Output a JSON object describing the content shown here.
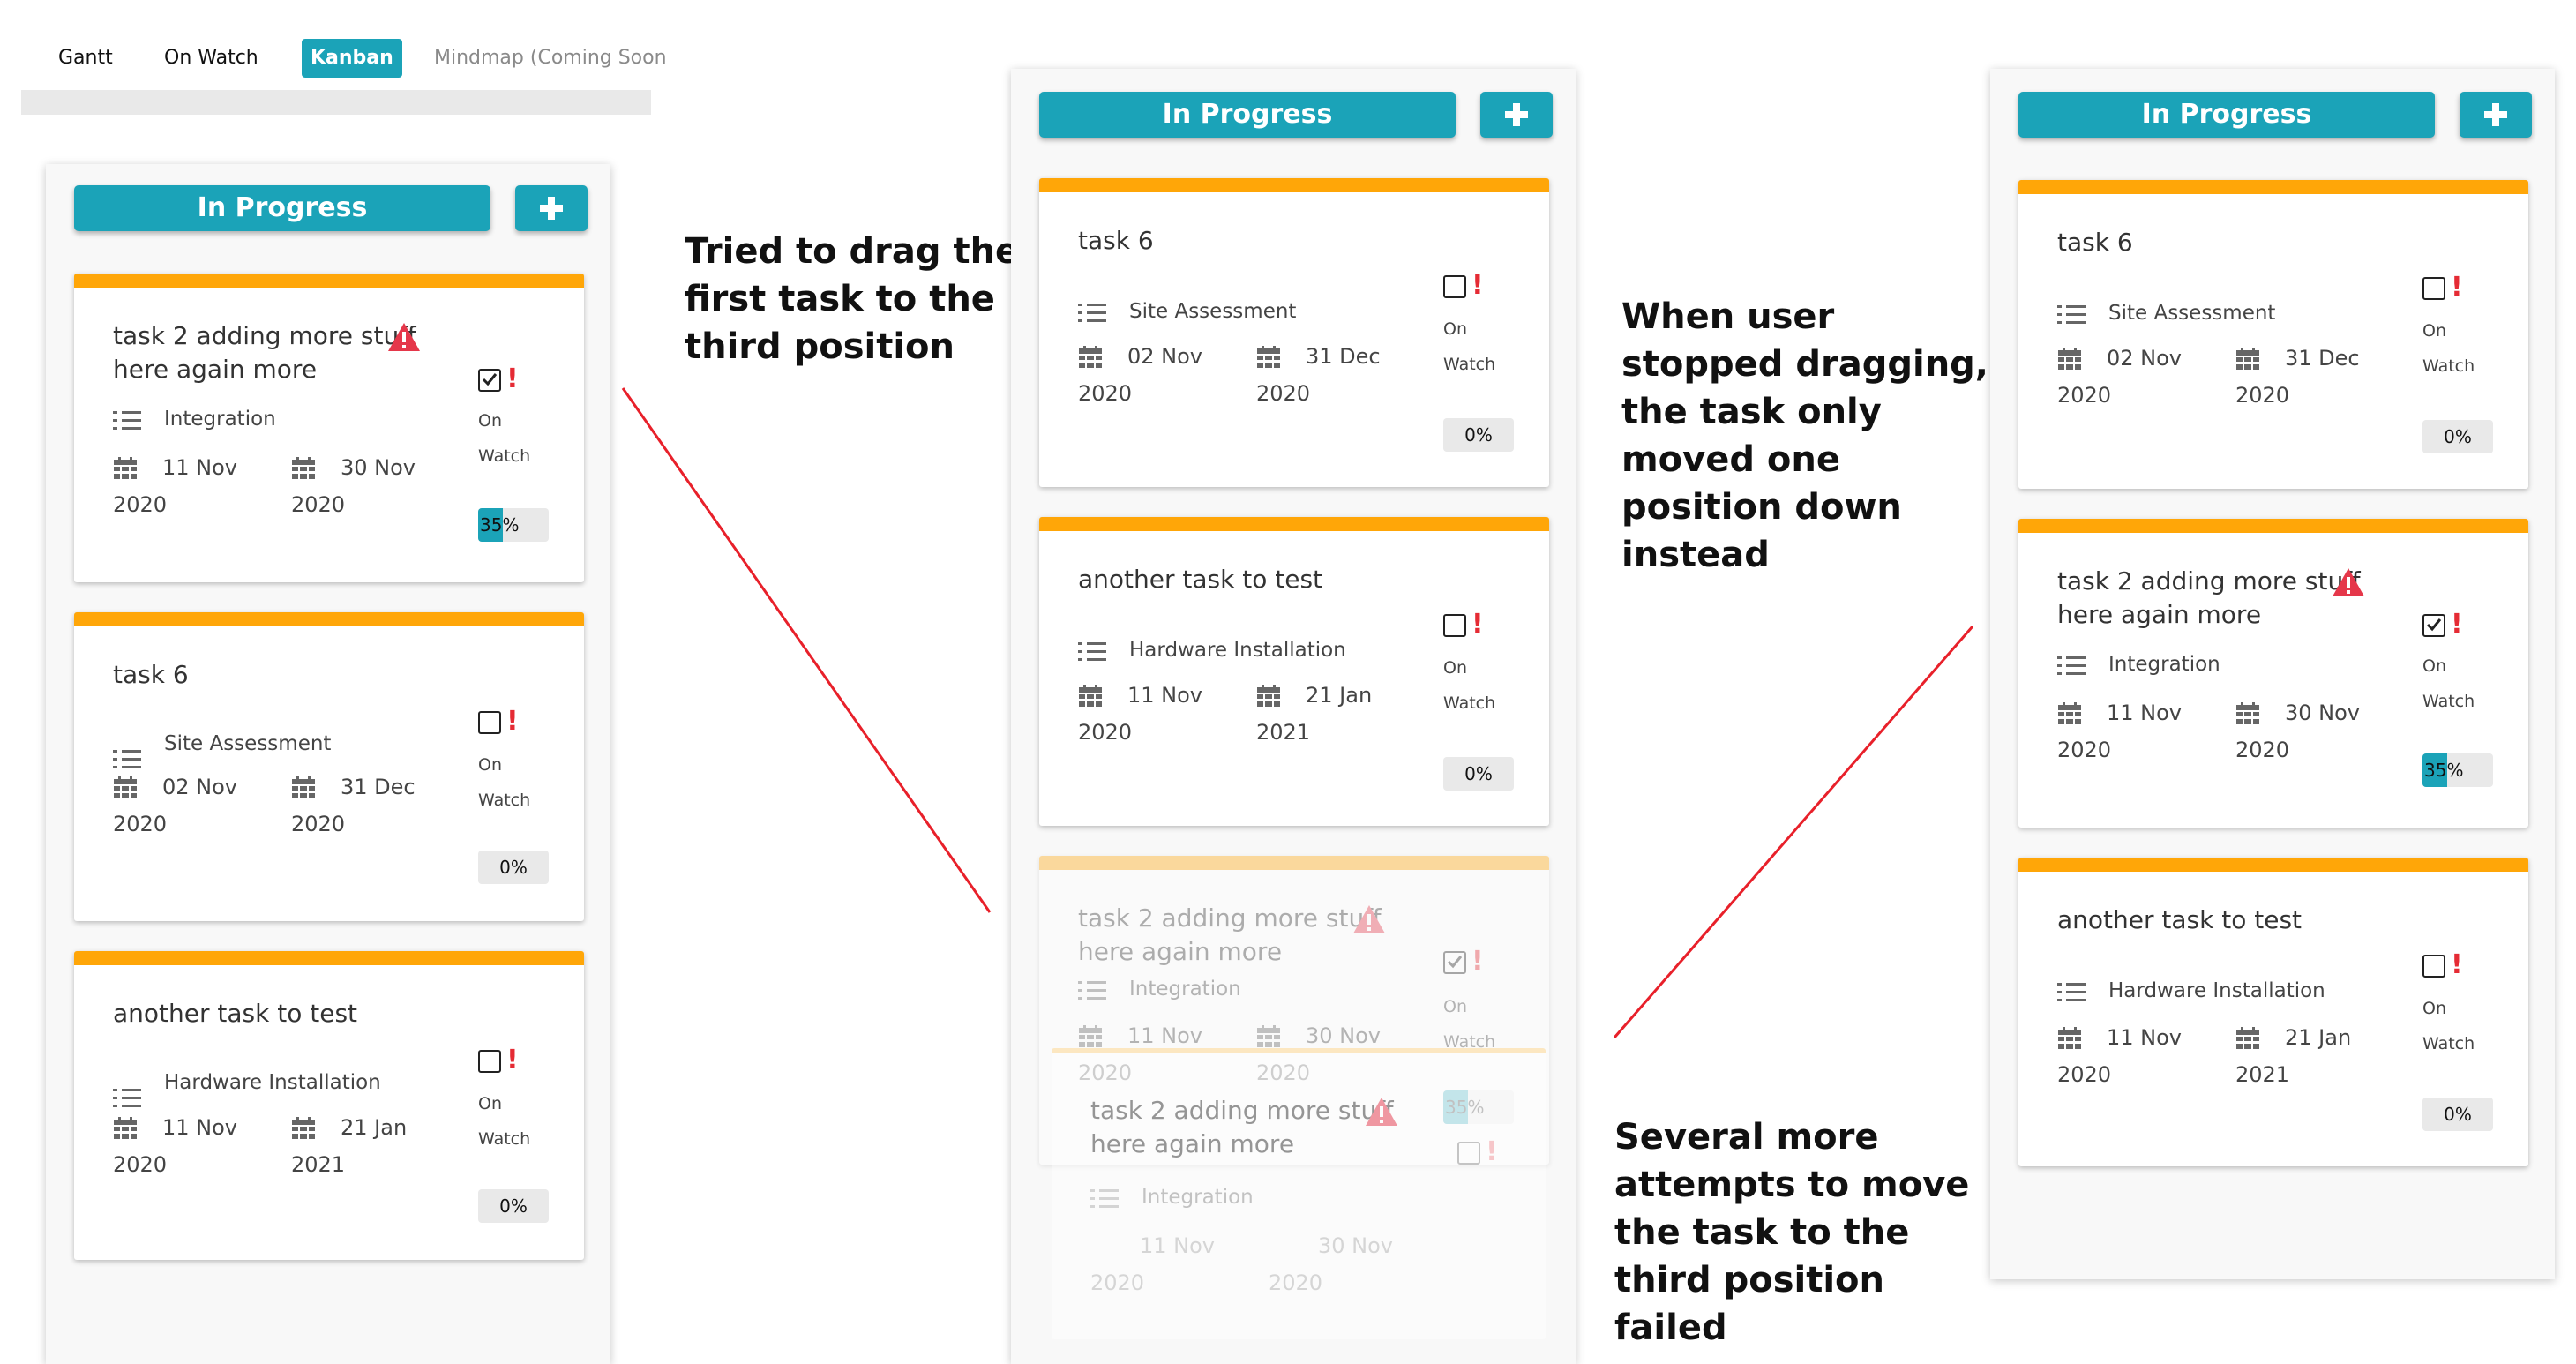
{
  "nav": {
    "tabs": [
      {
        "label": "Gantt",
        "active": false
      },
      {
        "label": "On Watch",
        "active": false
      },
      {
        "label": "Kanban",
        "active": true
      },
      {
        "label": "Mindmap (Coming Soon",
        "active": false
      }
    ]
  },
  "colors": {
    "accent": "#1ba3b8",
    "card_top": "#ffa608",
    "warning": "#e5374a",
    "flag": "#e52b34"
  },
  "icons": {
    "add": "plus-icon",
    "warning": "warning-triangle-icon",
    "category": "checklist-icon",
    "date": "calendar-icon",
    "watch": "checkbox-icon",
    "flag": "exclamation-icon"
  },
  "before": {
    "column_title": "In Progress",
    "cards": [
      {
        "title": "task 2 adding more stuff here again more",
        "warning": true,
        "category": "Integration",
        "start_day": "11 Nov",
        "start_year": "2020",
        "end_day": "30 Nov",
        "end_year": "2020",
        "watched": true,
        "watch_line1": "On",
        "watch_line2": "Watch",
        "progress_label": "35%",
        "progress": 0.35
      },
      {
        "title": "task 6",
        "warning": false,
        "category": "Site Assessment",
        "start_day": "02 Nov",
        "start_year": "2020",
        "end_day": "31 Dec",
        "end_year": "2020",
        "watched": false,
        "watch_line1": "On",
        "watch_line2": "Watch",
        "progress_label": "0%",
        "progress": 0
      },
      {
        "title": "another task to test",
        "warning": false,
        "category": "Hardware Installation",
        "start_day": "11 Nov",
        "start_year": "2020",
        "end_day": "21 Jan",
        "end_year": "2021",
        "watched": false,
        "watch_line1": "On",
        "watch_line2": "Watch",
        "progress_label": "0%",
        "progress": 0
      }
    ]
  },
  "during": {
    "column_title": "In Progress",
    "cards": [
      {
        "title": "task 6",
        "category": "Site Assessment",
        "start_day": "02 Nov",
        "start_year": "2020",
        "end_day": "31 Dec",
        "end_year": "2020",
        "watch_line1": "On",
        "watch_line2": "Watch",
        "progress_label": "0%"
      },
      {
        "title": "another task to test",
        "category": "Hardware Installation",
        "start_day": "11 Nov",
        "start_year": "2020",
        "end_day": "21 Jan",
        "end_year": "2021",
        "watch_line1": "On",
        "watch_line2": "Watch",
        "progress_label": "0%"
      },
      {
        "title": "task 2 adding more stuff here again more",
        "category": "Integration",
        "start_day": "11 Nov",
        "start_year": "2020",
        "end_day": "30 Nov",
        "end_year": "2020",
        "watch_line1": "On",
        "watch_line2": "Watch",
        "progress_label": "35%"
      }
    ]
  },
  "after": {
    "column_title": "In Progress",
    "cards": [
      {
        "title": "task 6",
        "category": "Site Assessment",
        "start_day": "02 Nov",
        "start_year": "2020",
        "end_day": "31 Dec",
        "end_year": "2020",
        "watch_line1": "On",
        "watch_line2": "Watch",
        "progress_label": "0%",
        "progress": 0
      },
      {
        "title": "task 2 adding more stuff here again more",
        "category": "Integration",
        "start_day": "11 Nov",
        "start_year": "2020",
        "end_day": "30 Nov",
        "end_year": "2020",
        "watch_line1": "On",
        "watch_line2": "Watch",
        "progress_label": "35%",
        "progress": 0.35
      },
      {
        "title": "another task to test",
        "category": "Hardware Installation",
        "start_day": "11 Nov",
        "start_year": "2020",
        "end_day": "21 Jan",
        "end_year": "2021",
        "watch_line1": "On",
        "watch_line2": "Watch",
        "progress_label": "0%",
        "progress": 0
      }
    ]
  },
  "annotations": {
    "drag_attempt": [
      "Tried to drag the",
      "first task to the",
      "third position"
    ],
    "result": [
      "When user",
      "stopped dragging,",
      "the task only",
      "moved one",
      "position down",
      "instead"
    ],
    "failed": [
      "Several more",
      "attempts to move",
      "the task to the",
      "third position",
      "failed"
    ]
  }
}
